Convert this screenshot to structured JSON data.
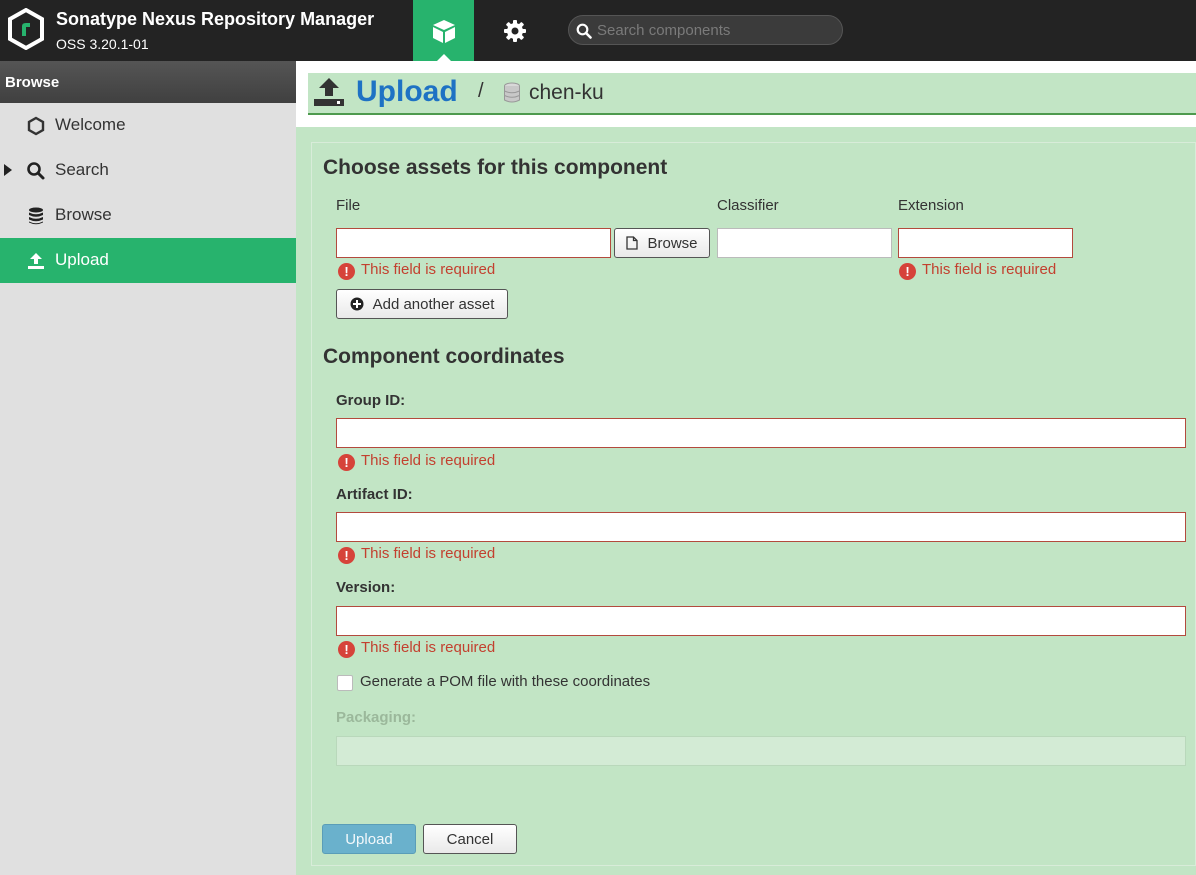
{
  "header": {
    "app_title": "Sonatype Nexus Repository Manager",
    "version": "OSS 3.20.1-01",
    "search_placeholder": "Search components"
  },
  "sidebar": {
    "header": "Browse",
    "items": [
      {
        "label": "Welcome",
        "icon": "hexagon-icon",
        "active": false
      },
      {
        "label": "Search",
        "icon": "search-icon",
        "active": false
      },
      {
        "label": "Browse",
        "icon": "database-icon",
        "active": false
      },
      {
        "label": "Upload",
        "icon": "upload-icon",
        "active": true
      }
    ]
  },
  "breadcrumb": {
    "title": "Upload",
    "separator": "/",
    "repository": "chen-ku"
  },
  "assets": {
    "heading": "Choose assets for this component",
    "file_label": "File",
    "classifier_label": "Classifier",
    "extension_label": "Extension",
    "file_value": "",
    "classifier_value": "",
    "extension_value": "",
    "browse_button": "Browse",
    "add_asset_button": "Add another asset",
    "file_error": "This field is required",
    "extension_error": "This field is required"
  },
  "coordinates": {
    "heading": "Component coordinates",
    "group_label": "Group ID:",
    "group_value": "",
    "group_error": "This field is required",
    "artifact_label": "Artifact ID:",
    "artifact_value": "",
    "artifact_error": "This field is required",
    "version_label": "Version:",
    "version_value": "",
    "version_error": "This field is required",
    "generate_pom_label": "Generate a POM file with these coordinates",
    "generate_pom_checked": false,
    "packaging_label": "Packaging:",
    "packaging_value": ""
  },
  "actions": {
    "upload_button": "Upload",
    "cancel_button": "Cancel"
  },
  "colors": {
    "accent_green": "#27b36d",
    "link_blue": "#1e72c4",
    "error_red": "#c3402f",
    "panel_bg": "#c2e5c5"
  }
}
